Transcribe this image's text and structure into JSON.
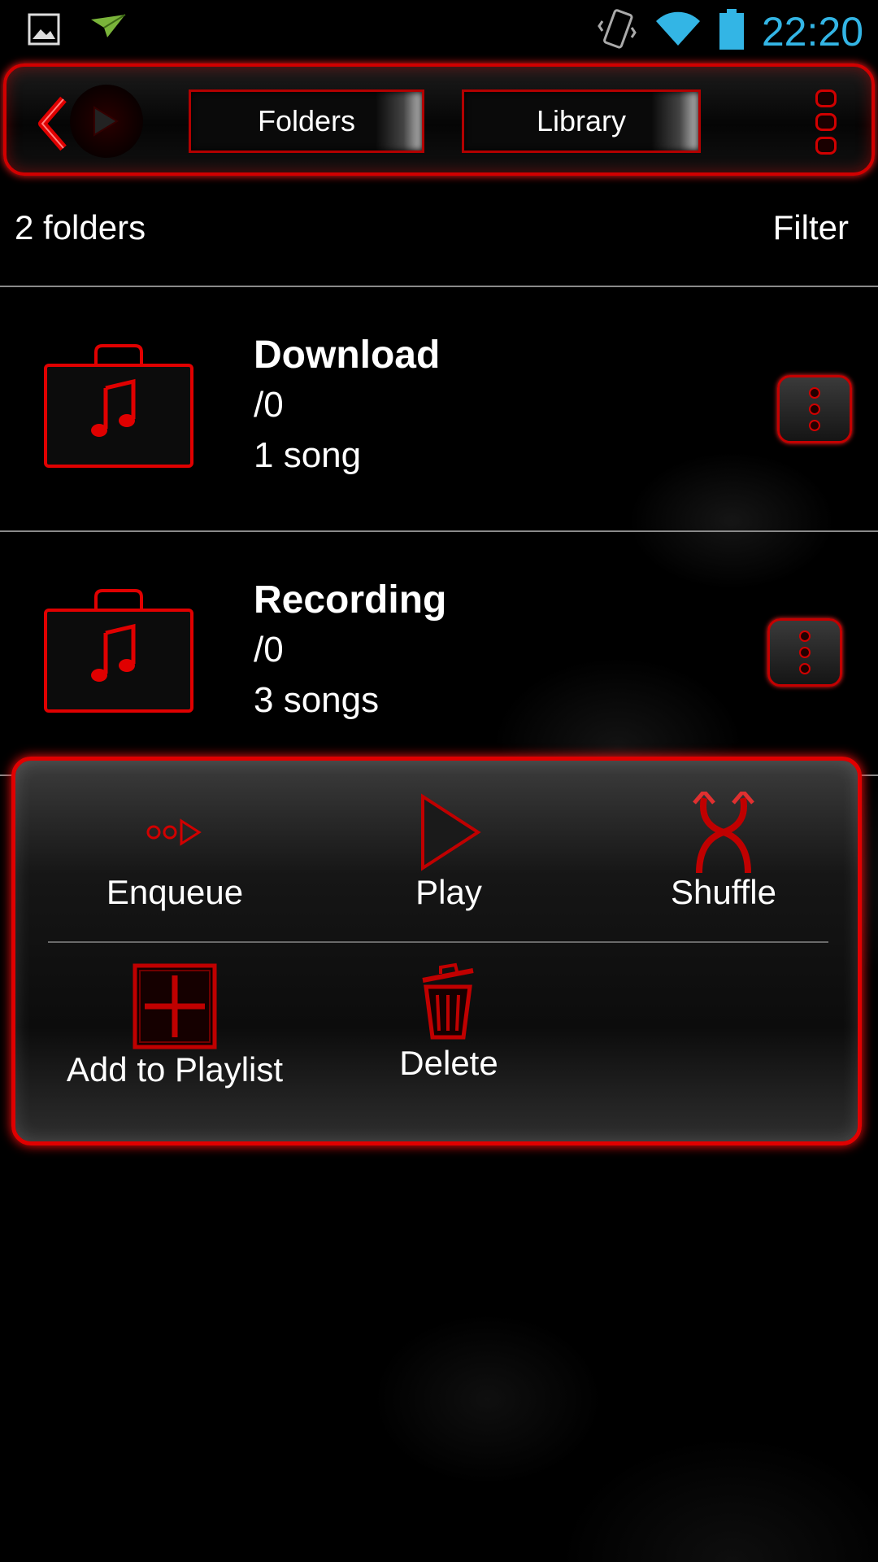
{
  "status_bar": {
    "time": "22:20",
    "icons": [
      "gallery-icon",
      "paper-plane-icon",
      "vibrate-icon",
      "wifi-icon",
      "battery-icon"
    ]
  },
  "toolbar": {
    "tabs": [
      {
        "label": "Folders"
      },
      {
        "label": "Library"
      }
    ]
  },
  "summary": {
    "count_label": "2 folders",
    "filter_label": "Filter"
  },
  "folders": [
    {
      "name": "Download",
      "path": "/0",
      "count": "1 song"
    },
    {
      "name": "Recording",
      "path": "/0",
      "count": "3 songs"
    }
  ],
  "quick_actions": [
    {
      "label": "Enqueue",
      "icon": "enqueue-icon"
    },
    {
      "label": "Play",
      "icon": "play-icon"
    },
    {
      "label": "Shuffle",
      "icon": "shuffle-icon"
    },
    {
      "label": "Add to Playlist",
      "icon": "add-playlist-icon"
    },
    {
      "label": "Delete",
      "icon": "trash-icon"
    }
  ],
  "colors": {
    "accent": "#d10000",
    "time_blue": "#33b5e5",
    "background": "#000000"
  }
}
